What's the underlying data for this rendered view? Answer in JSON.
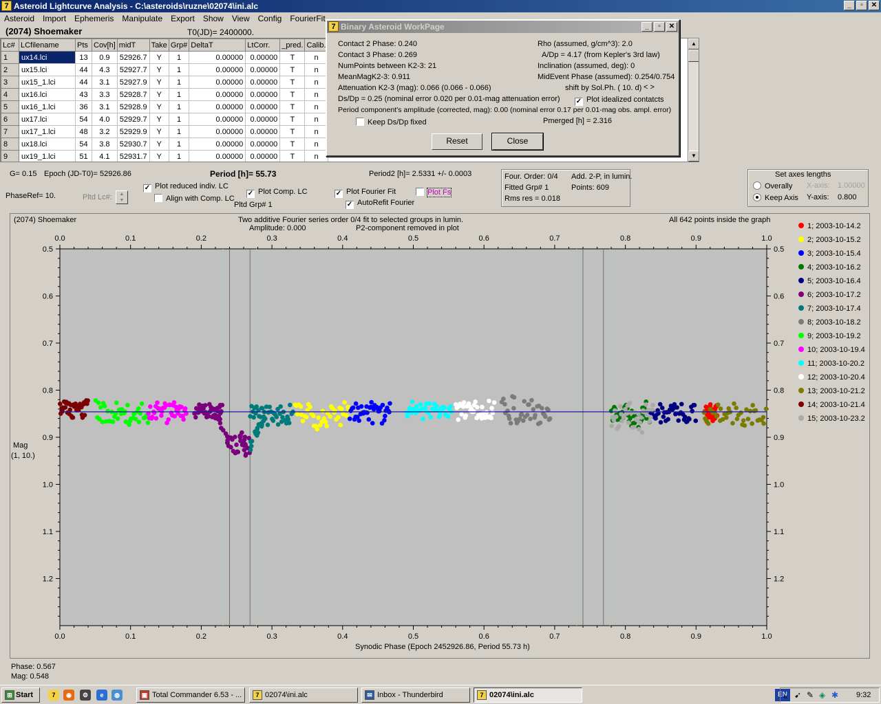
{
  "window": {
    "title": "Asteroid Lightcurve Analysis - C:\\asteroids\\ruzne\\02074\\ini.alc",
    "btn_min": "_",
    "btn_max": "▫",
    "btn_close": "✕"
  },
  "menu": [
    "Asteroid",
    "Import",
    "Ephemeris",
    "Manipulate",
    "Export",
    "Show",
    "View",
    "Config",
    "FourierFit"
  ],
  "header": {
    "asteroid": "(2074) Shoemaker",
    "t0": "T0(JD)= 2400000."
  },
  "table": {
    "columns": [
      "Lc#",
      "LCfilename",
      "Pts",
      "Cov[h]",
      "midT",
      "Take",
      "Grp#",
      "DeltaT",
      "LtCorr.",
      "_pred.",
      "Calib."
    ],
    "rows": [
      [
        "1",
        "ux14.lci",
        "13",
        "0.9",
        "52926.7",
        "Y",
        "1",
        "0.00000",
        "0.00000",
        "T",
        "n"
      ],
      [
        "2",
        "ux15.lci",
        "44",
        "4.3",
        "52927.7",
        "Y",
        "1",
        "0.00000",
        "0.00000",
        "T",
        "n"
      ],
      [
        "3",
        "ux15_1.lci",
        "44",
        "3.1",
        "52927.9",
        "Y",
        "1",
        "0.00000",
        "0.00000",
        "T",
        "n"
      ],
      [
        "4",
        "ux16.lci",
        "43",
        "3.3",
        "52928.7",
        "Y",
        "1",
        "0.00000",
        "0.00000",
        "T",
        "n"
      ],
      [
        "5",
        "ux16_1.lci",
        "36",
        "3.1",
        "52928.9",
        "Y",
        "1",
        "0.00000",
        "0.00000",
        "T",
        "n"
      ],
      [
        "6",
        "ux17.lci",
        "54",
        "4.0",
        "52929.7",
        "Y",
        "1",
        "0.00000",
        "0.00000",
        "T",
        "n"
      ],
      [
        "7",
        "ux17_1.lci",
        "48",
        "3.2",
        "52929.9",
        "Y",
        "1",
        "0.00000",
        "0.00000",
        "T",
        "n"
      ],
      [
        "8",
        "ux18.lci",
        "54",
        "3.8",
        "52930.7",
        "Y",
        "1",
        "0.00000",
        "0.00000",
        "T",
        "n"
      ],
      [
        "9",
        "ux19_1.lci",
        "51",
        "4.1",
        "52931.7",
        "Y",
        "1",
        "0.00000",
        "0.00000",
        "T",
        "n"
      ]
    ]
  },
  "dialog": {
    "title": "Binary Asteroid WorkPage",
    "contact2": "Contact 2 Phase:   0.240",
    "contact3": "Contact 3 Phase:   0.269",
    "numpoints": "NumPoints between K2-3:    21",
    "meanmag": "MeanMagK2-3:   0.911",
    "attenuation": "Attenuation K2-3 (mag):  0.066  (0.066 - 0.066)",
    "dsdp": "Ds/Dp = 0.25 (nominal error 0.020 per 0.01-mag attenuation error)",
    "period_amp": "Period component's amplitude (corrected, mag): 0.00 (nominal error 0.17 per 0.01-mag obs. ampl. error)",
    "keep_dsdp": "Keep Ds/Dp fixed",
    "rho": "Rho (assumed, g/cm^3): 2.0",
    "adp": "A/Dp = 4.17 (from Kepler's 3rd law)",
    "inclination": "Inclination (assumed, deg): 0",
    "midevent": "MidEvent Phase (assumed): 0.254/0.754",
    "shift": "shift by Sol.Ph. ( 10. d)",
    "shift_arrows": "< >",
    "plot_idealized": "Plot idealized contatcts",
    "pmerged": "Pmerged [h] =  2.316",
    "reset": "Reset",
    "close": "Close"
  },
  "controls": {
    "g": "G= 0.15",
    "epoch": "Epoch (JD-T0)= 52926.86",
    "period": "Period [h]= 55.73",
    "period2": "Period2 [h]= 2.5331 +/- 0.0003",
    "phaseref": "PhaseRef= 10.",
    "pltd_lc": "Pltd Lc#:",
    "plot_reduced": "Plot reduced indiv. LC",
    "align": "Align with Comp. LC",
    "plot_comp": "Plot Comp. LC",
    "pltd_grp": "Pltd Grp#  1",
    "plot_fourier": "Plot Fourier Fit",
    "autorefit": "AutoRefit Fourier",
    "plot_fs": "Plot Fs",
    "four_order": "Four. Order:  0/4",
    "add2p": "Add. 2-P, in lumin.",
    "fitted_grp": "Fitted Grp# 1",
    "points": "Points: 609",
    "rms": "Rms res      = 0.018",
    "axes_title": "Set axes lengths",
    "overally": "Overally",
    "keep_axis": "Keep Axis",
    "xaxis_label": "X-axis:",
    "xaxis_val": "1.00000",
    "yaxis_label": "Y-axis:",
    "yaxis_val": "0.800"
  },
  "plot": {
    "name": "(2074) Shoemaker",
    "desc1": "Two additive Fourier series order 0/4 fit to selected groups in lumin.",
    "amplitude": "Amplitude: 0.000",
    "desc2": "P2-component removed in plot",
    "inside": "All 642 points inside the graph",
    "ylabel1": "Mag",
    "ylabel2": "(1, 10.)",
    "xlabel": "Synodic Phase (Epoch 2452926.86, Period 55.73 h)",
    "phase_readout": "Phase: 0.567",
    "mag_readout": "Mag:   0.548"
  },
  "chart_data": {
    "type": "scatter",
    "xlim": [
      0.0,
      1.0
    ],
    "ylim": [
      1.3,
      0.5
    ],
    "inverted_y": true,
    "x_ticks": [
      "0.0",
      "0.1",
      "0.2",
      "0.3",
      "0.4",
      "0.5",
      "0.6",
      "0.7",
      "0.8",
      "0.9",
      "1.0"
    ],
    "y_ticks": [
      "0.5",
      "0.6",
      "0.7",
      "0.8",
      "0.9",
      "1.0",
      "1.1",
      "1.2"
    ],
    "fit_line_mag": 0.846,
    "contact_lines_x": [
      0.24,
      0.269,
      0.74,
      0.769
    ],
    "contact_lines_faint_x": [
      0.231,
      0.278,
      0.731,
      0.778
    ],
    "series": [
      {
        "name": "1; 2003-10-14.2",
        "color": "#ff0000",
        "x_range": [
          0.912,
          0.93
        ],
        "mag": 0.848,
        "spread": 0.03
      },
      {
        "name": "2; 2003-10-15.2",
        "color": "#ffff00",
        "x_range": [
          0.332,
          0.41
        ],
        "mag": 0.855,
        "spread": 0.045
      },
      {
        "name": "3; 2003-10-15.4",
        "color": "#0000ff",
        "x_range": [
          0.41,
          0.468
        ],
        "mag": 0.846,
        "spread": 0.04
      },
      {
        "name": "4; 2003-10-16.2",
        "color": "#007700",
        "x_range": [
          0.78,
          0.835
        ],
        "mag": 0.855,
        "spread": 0.045
      },
      {
        "name": "5; 2003-10-16.4",
        "color": "#000080",
        "x_range": [
          0.835,
          0.9
        ],
        "mag": 0.85,
        "spread": 0.035
      },
      {
        "name": "6; 2003-10-17.2",
        "color": "#7b007b",
        "x_range": [
          0.19,
          0.23
        ],
        "mag": 0.846,
        "spread": 0.03
      },
      {
        "name": "7; 2003-10-17.4",
        "color": "#007b7b",
        "x_range": [
          0.269,
          0.33
        ],
        "mag": 0.85,
        "spread": 0.04
      },
      {
        "name": "8; 2003-10-18.2",
        "color": "#7b7b7b",
        "x_range": [
          0.625,
          0.695
        ],
        "mag": 0.846,
        "spread": 0.05
      },
      {
        "name": "9; 2003-10-19.2",
        "color": "#00ff00",
        "x_range": [
          0.05,
          0.125
        ],
        "mag": 0.85,
        "spread": 0.045
      },
      {
        "name": "10; 2003-10-19.4",
        "color": "#ff00ff",
        "x_range": [
          0.125,
          0.18
        ],
        "mag": 0.848,
        "spread": 0.035
      },
      {
        "name": "11; 2003-10-20.2",
        "color": "#00ffff",
        "x_range": [
          0.49,
          0.555
        ],
        "mag": 0.843,
        "spread": 0.03
      },
      {
        "name": "12; 2003-10-20.4",
        "color": "#ffffff",
        "x_range": [
          0.56,
          0.615
        ],
        "mag": 0.845,
        "spread": 0.035
      },
      {
        "name": "13; 2003-10-21.2",
        "color": "#7b7b00",
        "x_range": [
          0.91,
          1.0
        ],
        "mag": 0.852,
        "spread": 0.045
      },
      {
        "name": "14; 2003-10-21.4",
        "color": "#7b0000",
        "x_range": [
          0.0,
          0.04
        ],
        "mag": 0.84,
        "spread": 0.03
      },
      {
        "name": "15; 2003-10-23.2",
        "color": "#aaaaaa",
        "x_range": [
          0.78,
          0.84
        ],
        "mag": 0.86,
        "spread": 0.05
      }
    ],
    "eclipse": {
      "x_range": [
        0.24,
        0.269
      ],
      "mag": 0.915,
      "color": "#7b007b"
    }
  },
  "taskbar": {
    "start": "Start",
    "tasks": [
      "Total Commander 6.53 - ...",
      "02074\\ini.alc",
      "Inbox - Thunderbird",
      "02074\\ini.alc"
    ],
    "lang": "EN",
    "clock": "9:32"
  }
}
